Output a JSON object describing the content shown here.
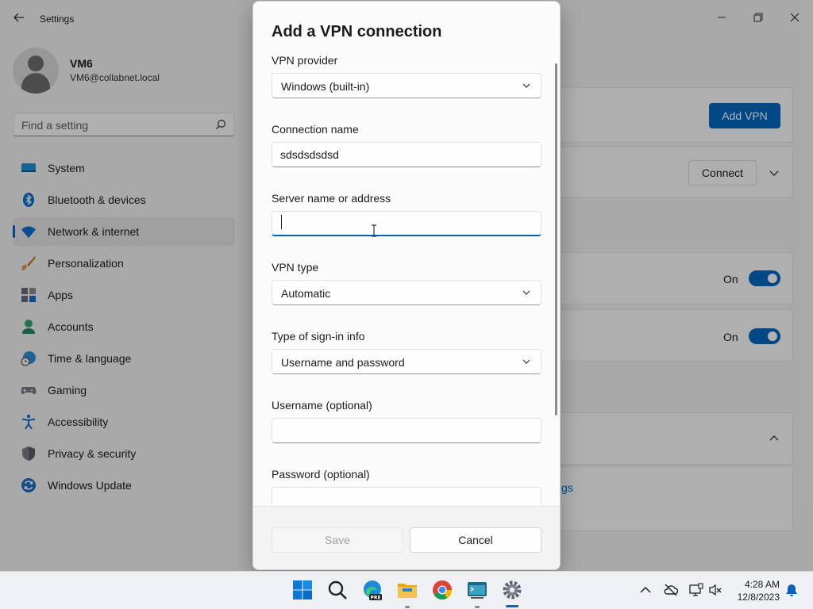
{
  "settings": {
    "title": "Settings",
    "profile": {
      "name": "VM6",
      "email": "VM6@collabnet.local"
    },
    "search_placeholder": "Find a setting",
    "nav": [
      {
        "label": "System",
        "icon": "system-icon"
      },
      {
        "label": "Bluetooth & devices",
        "icon": "bluetooth-icon"
      },
      {
        "label": "Network & internet",
        "icon": "wifi-icon",
        "active": true
      },
      {
        "label": "Personalization",
        "icon": "brush-icon"
      },
      {
        "label": "Apps",
        "icon": "apps-icon"
      },
      {
        "label": "Accounts",
        "icon": "accounts-icon"
      },
      {
        "label": "Time & language",
        "icon": "clock-globe-icon"
      },
      {
        "label": "Gaming",
        "icon": "gamepad-icon"
      },
      {
        "label": "Accessibility",
        "icon": "accessibility-icon"
      },
      {
        "label": "Privacy & security",
        "icon": "shield-icon"
      },
      {
        "label": "Windows Update",
        "icon": "update-icon"
      }
    ],
    "main": {
      "add_vpn_label": "Add VPN",
      "connect_label": "Connect",
      "toggle1_label": "On",
      "toggle2_label": "On",
      "link_fragment": "gs"
    }
  },
  "dialog": {
    "title": "Add a VPN connection",
    "fields": {
      "provider": {
        "label": "VPN provider",
        "value": "Windows (built-in)"
      },
      "connection_name": {
        "label": "Connection name",
        "value": "sdsdsdsdsd"
      },
      "server": {
        "label": "Server name or address",
        "value": ""
      },
      "vpn_type": {
        "label": "VPN type",
        "value": "Automatic"
      },
      "signin_type": {
        "label": "Type of sign-in info",
        "value": "Username and password"
      },
      "username": {
        "label": "Username (optional)",
        "value": ""
      },
      "password": {
        "label": "Password (optional)"
      }
    },
    "save_label": "Save",
    "cancel_label": "Cancel"
  },
  "taskbar": {
    "icons": [
      "start-icon",
      "search-icon",
      "edge-preview-icon",
      "file-explorer-icon",
      "chrome-icon",
      "terminal-icon",
      "settings-icon"
    ],
    "clock": {
      "time": "4:28 AM",
      "date": "12/8/2023"
    }
  },
  "colors": {
    "accent": "#0067c0",
    "focus": "#005fb8"
  }
}
